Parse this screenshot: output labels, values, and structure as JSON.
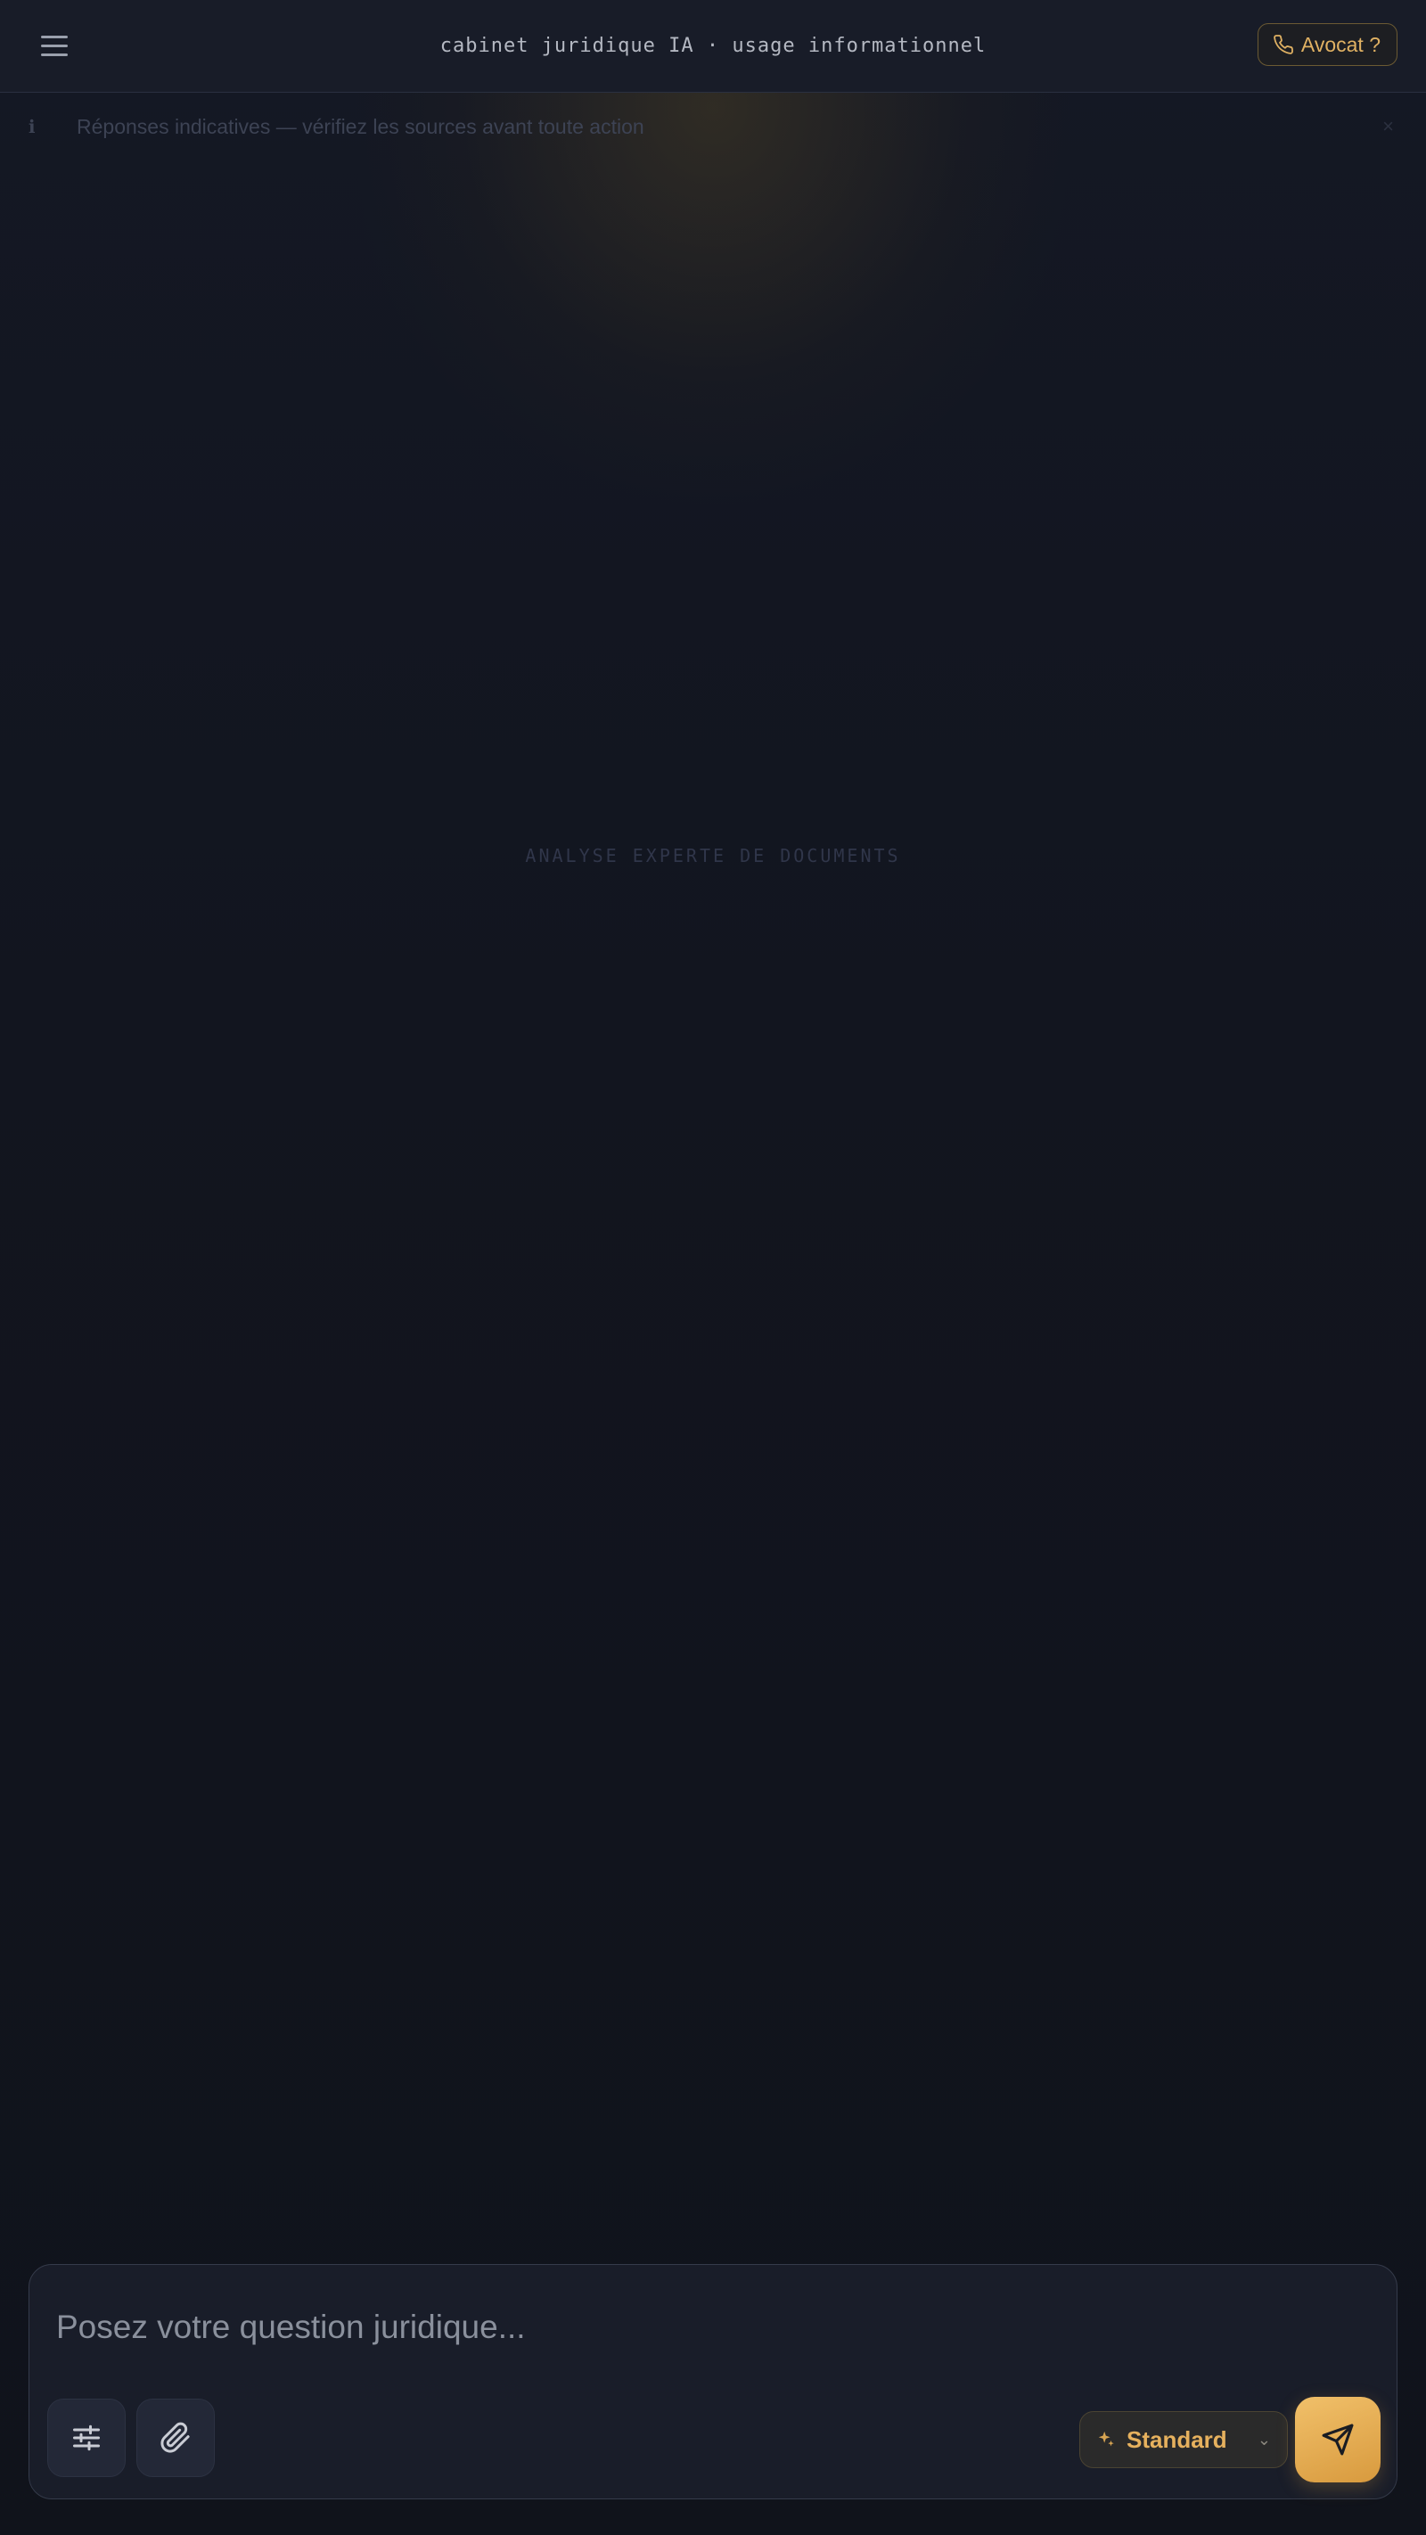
{
  "header": {
    "title": "cabinet juridique IA · usage informationnel",
    "lawyer_button_label": "Avocat ?"
  },
  "disclaimer": {
    "icon": "ℹ",
    "text": "Réponses indicatives — vérifiez les sources avant toute action",
    "close": "×"
  },
  "hero": {
    "label": "ANALYSE EXPERTE DE DOCUMENTS"
  },
  "composer": {
    "placeholder": "Posez votre question juridique...",
    "mode_label": "Standard"
  },
  "colors": {
    "accent": "#e6b15e",
    "background": "#11141d",
    "surface": "#191d29"
  },
  "icons": {
    "menu": "menu-icon",
    "phone": "phone-icon",
    "settings": "sliders-icon",
    "attach": "paperclip-icon",
    "mode": "sparkle-icon",
    "chevron": "chevron-down-icon",
    "send": "send-icon"
  }
}
